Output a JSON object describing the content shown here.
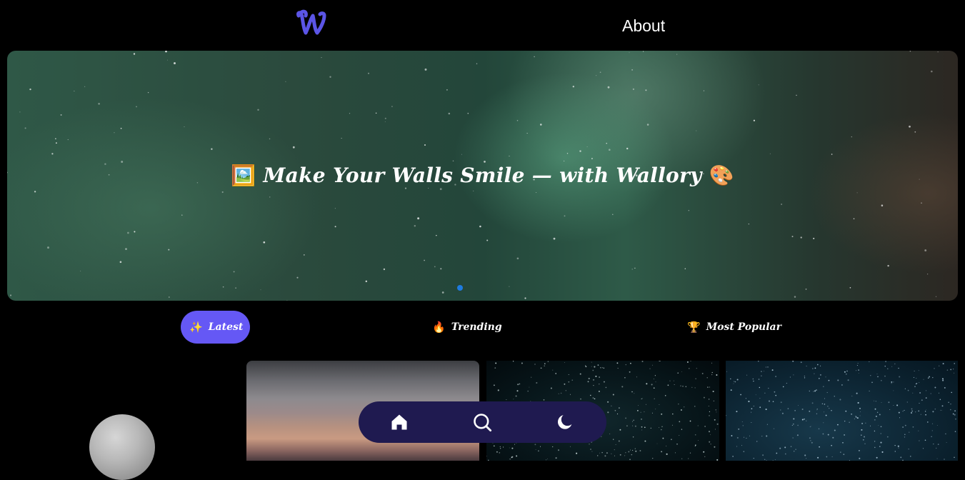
{
  "header": {
    "logo_letter": "W",
    "logo_color": "#5b55e6",
    "about_label": "About"
  },
  "hero": {
    "title": "Make Your Walls Smile — with Wallory",
    "icon_left": "🖼️",
    "icon_right": "🎨",
    "slide_indicator_color": "#1e7be0"
  },
  "tabs": [
    {
      "icon": "✨",
      "label": "Latest",
      "active": true
    },
    {
      "icon": "🔥",
      "label": "Trending",
      "active": false
    },
    {
      "icon": "🏆",
      "label": "Most Popular",
      "active": false
    }
  ],
  "bottom_nav": {
    "background": "#1f1a50",
    "items": [
      "home-icon",
      "search-icon",
      "moon-icon"
    ]
  },
  "colors": {
    "accent": "#6558f5"
  }
}
